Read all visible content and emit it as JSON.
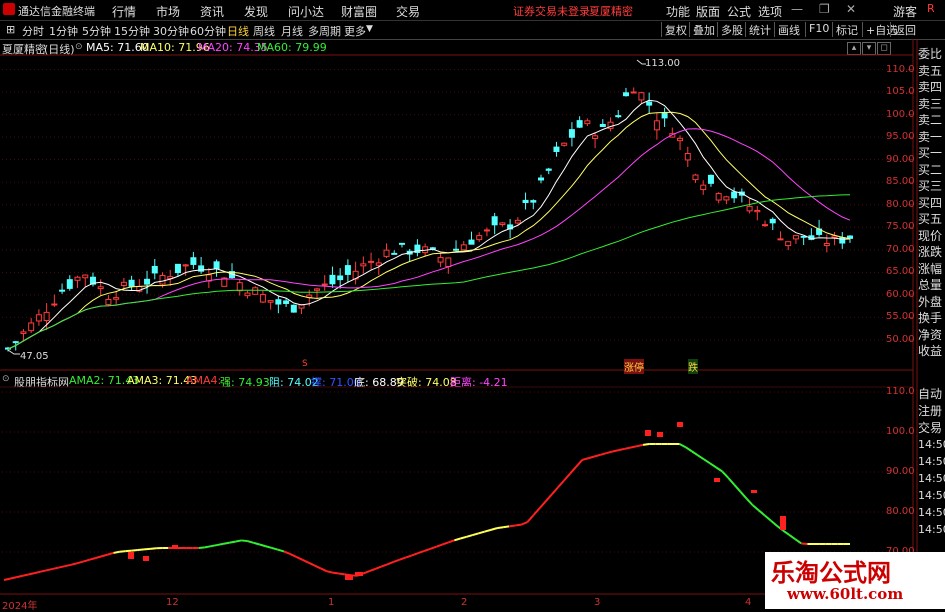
{
  "menubar": {
    "app_title": "通达信金融终端",
    "items": [
      "行情",
      "市场",
      "资讯",
      "发现",
      "问小达",
      "财富圈",
      "交易"
    ],
    "notice": "证券交易未登录",
    "stock": "夏厦精密",
    "right_items": [
      "功能",
      "版面",
      "公式",
      "选项"
    ],
    "user": "游客"
  },
  "periods": [
    "分时",
    "1分钟",
    "5分钟",
    "15分钟",
    "30分钟",
    "60分钟",
    "日线",
    "周线",
    "月线",
    "多周期",
    "更多"
  ],
  "active_period": "日线",
  "right_buttons": [
    "复权",
    "叠加",
    "多股",
    "统计",
    "画线",
    "F10",
    "标记",
    "+自选",
    "返回"
  ],
  "main_legend": {
    "name": "夏厦精密",
    "period": "(日线)",
    "ma5": "MA5: 71.60",
    "ma10": "MA10: 71.96",
    "ma20": "MA20: 74.35",
    "ma60": "MA60: 79.99"
  },
  "sub_legend": {
    "name": "股朋指标网",
    "ama2": "AMA2: 71.43",
    "ama3": "AMA3: 71.43",
    "ama4": "AMA4: -",
    "strong": "强: 74.93",
    "resist": "阻: 74.02",
    "support": "撑: 71.00",
    "bottom": "底: 68.89",
    "breakout": "突破: 74.08",
    "distance": "距离: -4.21"
  },
  "main_yaxis": [
    "110.0",
    "105.0",
    "100.0",
    "95.00",
    "90.00",
    "85.00",
    "80.00",
    "75.00",
    "70.00",
    "65.00",
    "60.00",
    "55.00",
    "50.00"
  ],
  "sub_yaxis": [
    "110.0",
    "100.0",
    "90.00",
    "80.00",
    "70.00"
  ],
  "sub_side_times": [
    "14:50",
    "14:50",
    "14:50",
    "14:50",
    "14:50",
    "14:50"
  ],
  "high_label": "113.00",
  "low_label": "47.05",
  "markers": {
    "s": "S",
    "zt": "涨停",
    "die": "跌"
  },
  "side_panel": [
    "委比",
    "卖五",
    "卖四",
    "卖三",
    "卖二",
    "卖一",
    "买一",
    "买二",
    "买三",
    "买四",
    "买五",
    "现价",
    "涨跌",
    "涨幅",
    "总量",
    "外盘",
    "换手",
    "净资",
    "收益"
  ],
  "side_panel2": [
    "自动",
    "注册",
    "交易"
  ],
  "x_axis": [
    "2024年",
    "12",
    "1",
    "2",
    "3",
    "4"
  ],
  "corner": "R",
  "watermark": {
    "line1": "乐淘公式网",
    "line2": "www.60lt.com"
  },
  "colors": {
    "up": "#ff3b3b",
    "down": "#54ffff",
    "ma5": "#ffffff",
    "ma10": "#ffff66",
    "ma20": "#ff44ff",
    "ma60": "#33ee33"
  }
}
